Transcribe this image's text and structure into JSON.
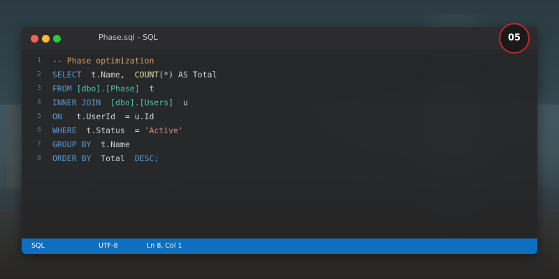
{
  "window": {
    "title": "Phase.sql - SQL",
    "badge": "05"
  },
  "editor": {
    "lines": [
      {
        "number": "1",
        "tokens": [
          {
            "t": "-- Phase optimization",
            "c": "cm"
          }
        ]
      },
      {
        "number": "2",
        "tokens": [
          {
            "t": "SELECT",
            "c": "kw"
          },
          {
            "t": "  t.Name,  ",
            "c": "txt"
          },
          {
            "t": "COUNT",
            "c": "fn"
          },
          {
            "t": "(*) AS Total",
            "c": "txt"
          }
        ]
      },
      {
        "number": "3",
        "tokens": [
          {
            "t": "FROM",
            "c": "kw"
          },
          {
            "t": " ",
            "c": "txt"
          },
          {
            "t": "[dbo].[Phase]",
            "c": "obj"
          },
          {
            "t": "  t",
            "c": "txt"
          }
        ]
      },
      {
        "number": "4",
        "tokens": [
          {
            "t": "INNER JOIN",
            "c": "kw"
          },
          {
            "t": "  ",
            "c": "txt"
          },
          {
            "t": "[dbo].[Users]",
            "c": "obj"
          },
          {
            "t": "  u",
            "c": "txt"
          }
        ]
      },
      {
        "number": "5",
        "tokens": [
          {
            "t": "ON",
            "c": "kw"
          },
          {
            "t": "   t.UserId  = u.Id",
            "c": "txt"
          }
        ]
      },
      {
        "number": "6",
        "tokens": [
          {
            "t": "WHERE",
            "c": "kw"
          },
          {
            "t": "  t.Status  = ",
            "c": "txt"
          },
          {
            "t": "'Active'",
            "c": "str"
          }
        ]
      },
      {
        "number": "7",
        "tokens": [
          {
            "t": "GROUP BY",
            "c": "kw"
          },
          {
            "t": "  t.Name",
            "c": "txt"
          }
        ]
      },
      {
        "number": "8",
        "tokens": [
          {
            "t": "ORDER BY",
            "c": "kw"
          },
          {
            "t": "  Total  ",
            "c": "txt"
          },
          {
            "t": "DESC;",
            "c": "kw"
          }
        ]
      }
    ]
  },
  "statusbar": {
    "language": "SQL",
    "encoding": "UTF-8",
    "position": "Ln 8, Col 1"
  },
  "colors": {
    "statusbar": "#0e6fc0",
    "keyword": "#569cd6",
    "function": "#dcdcaa",
    "string": "#ce9178",
    "comment": "#d6a062",
    "object": "#4ec9b0",
    "badge_border": "#c8262b"
  }
}
